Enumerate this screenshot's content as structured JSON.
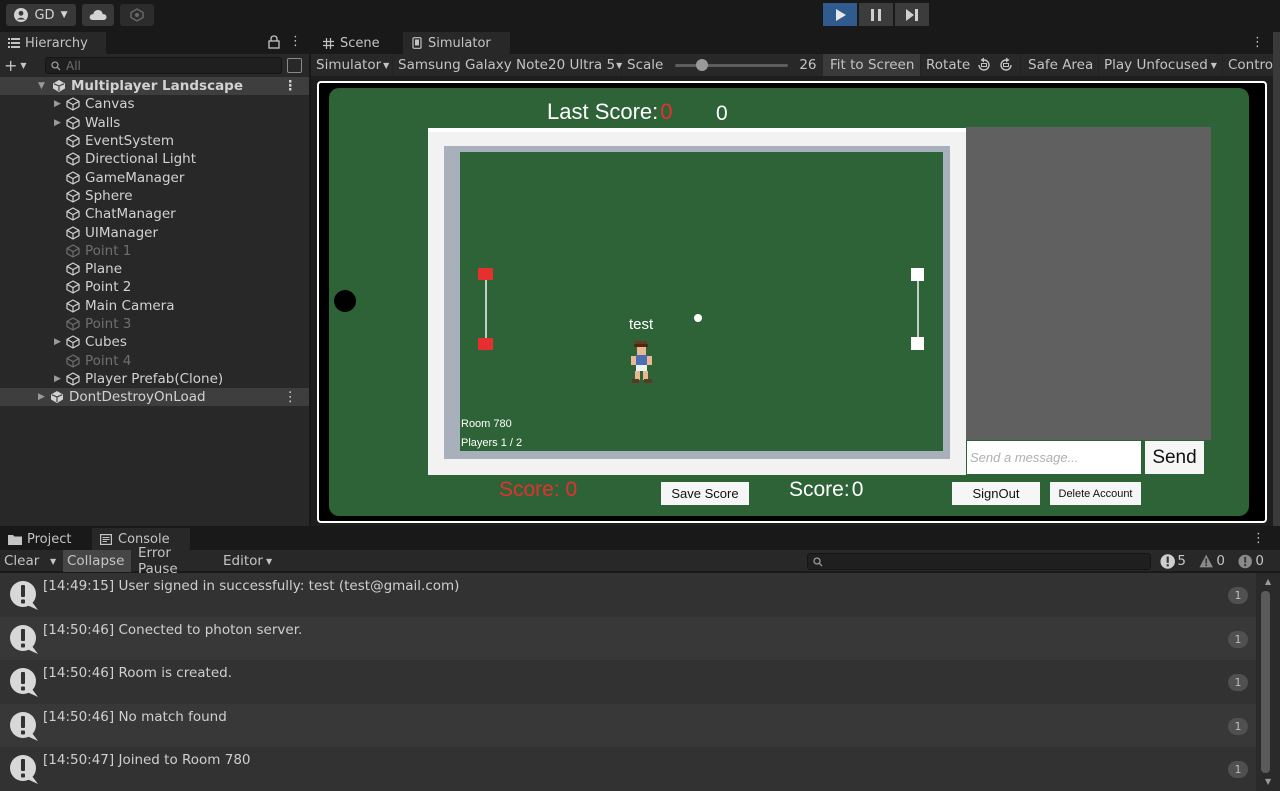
{
  "toolbar": {
    "account_label": "GD"
  },
  "hierarchy": {
    "tab_label": "Hierarchy",
    "search_placeholder": "All",
    "scene_name": "Multiplayer Landscape",
    "items": [
      {
        "label": "Canvas",
        "expandable": true,
        "active": true
      },
      {
        "label": "Walls",
        "expandable": true,
        "active": true
      },
      {
        "label": "EventSystem",
        "expandable": false,
        "active": true
      },
      {
        "label": "Directional Light",
        "expandable": false,
        "active": true
      },
      {
        "label": "GameManager",
        "expandable": false,
        "active": true
      },
      {
        "label": "Sphere",
        "expandable": false,
        "active": true
      },
      {
        "label": "ChatManager",
        "expandable": false,
        "active": true
      },
      {
        "label": "UIManager",
        "expandable": false,
        "active": true
      },
      {
        "label": "Point 1",
        "expandable": false,
        "active": false
      },
      {
        "label": "Plane",
        "expandable": false,
        "active": true
      },
      {
        "label": "Point 2",
        "expandable": false,
        "active": true
      },
      {
        "label": "Main Camera",
        "expandable": false,
        "active": true
      },
      {
        "label": "Point 3",
        "expandable": false,
        "active": false
      },
      {
        "label": "Cubes",
        "expandable": true,
        "active": true
      },
      {
        "label": "Point 4",
        "expandable": false,
        "active": false
      },
      {
        "label": "Player Prefab(Clone)",
        "expandable": true,
        "active": true
      }
    ],
    "dont_destroy_label": "DontDestroyOnLoad"
  },
  "simulator": {
    "tabs": [
      "Scene",
      "Simulator"
    ],
    "mode_label": "Simulator",
    "device_label": "Samsung Galaxy Note20 Ultra 5",
    "scale_label": "Scale",
    "scale_value": "26",
    "scale_fraction": 0.2,
    "fit_label": "Fit to Screen",
    "rotate_label": "Rotate",
    "safe_area_label": "Safe Area",
    "play_unfocused_label": "Play Unfocused",
    "control_label": "Contro"
  },
  "game": {
    "last_score_label": "Last Score:",
    "last_score_value": "0",
    "top_score_value": "0",
    "player_name": "test",
    "room_label": "Room 780",
    "players_label": "Players 1 / 2",
    "chat_placeholder": "Send a message...",
    "send_label": "Send",
    "left_score_label": "Score: 0",
    "save_score_label": "Save Score",
    "score_label": "Score:",
    "score_value": "0",
    "signout_label": "SignOut",
    "delete_account_label": "Delete Account",
    "colors": {
      "field": "#2e6337",
      "red": "#e53030",
      "wall": "#f2f2f2"
    }
  },
  "console": {
    "tabs": [
      "Project",
      "Console"
    ],
    "clear_label": "Clear",
    "collapse_label": "Collapse",
    "error_pause_label": "Error Pause",
    "editor_label": "Editor",
    "log_count": "5",
    "warn_count": "0",
    "error_count": "0",
    "entries": [
      {
        "text": "[14:49:15] User signed in successfully: test (test@gmail.com)",
        "count": "1"
      },
      {
        "text": "[14:50:46] Conected to photon server.",
        "count": "1"
      },
      {
        "text": "[14:50:46] Room is created.",
        "count": "1"
      },
      {
        "text": "[14:50:46] No match found",
        "count": "1"
      },
      {
        "text": "[14:50:47] Joined to Room 780",
        "count": "1"
      }
    ]
  }
}
